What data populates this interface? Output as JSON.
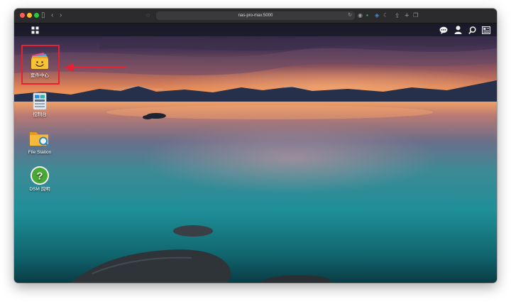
{
  "browser": {
    "url": "nas-pro-max:5000"
  },
  "taskbar": {
    "main_menu_icon": "grid-icon",
    "right_icons": [
      "chat-icon",
      "user-icon",
      "search-icon",
      "widgets-icon"
    ]
  },
  "desktop": {
    "items": [
      {
        "label": "套件中心",
        "icon": "package-center-icon"
      },
      {
        "label": "控制台",
        "icon": "control-panel-icon"
      },
      {
        "label": "File Station",
        "icon": "folder-search-icon"
      },
      {
        "label": "DSM 說明",
        "icon": "help-icon"
      }
    ]
  },
  "colors": {
    "highlight": "#e8202f",
    "taskbar": "#161822"
  }
}
